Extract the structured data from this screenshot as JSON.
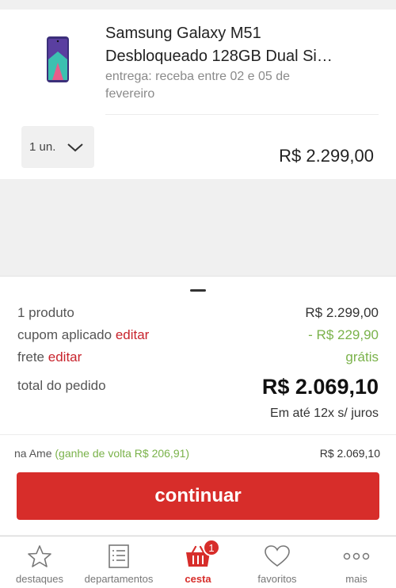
{
  "product": {
    "name_line1": "Samsung Galaxy M51",
    "name_line2": "Desbloqueado 128GB Dual Si…",
    "delivery_line1": "entrega: receba entre 02 e 05 de",
    "delivery_line2": "fevereiro",
    "quantity": "1 un.",
    "price": "R$ 2.299,00",
    "image_icon": "phone-thumbnail"
  },
  "summary": {
    "products_label": "1 produto",
    "products_value": "R$ 2.299,00",
    "coupon_label": "cupom aplicado",
    "coupon_edit": "editar",
    "coupon_value": "- R$ 229,90",
    "shipping_label": "frete",
    "shipping_edit": "editar",
    "shipping_value": "grátis",
    "total_label": "total do pedido",
    "total_value": "R$ 2.069,10",
    "installments": "Em até 12x s/ juros"
  },
  "ame": {
    "label": "na Ame",
    "cashback": "(ganhe de volta R$ 206,91)",
    "total": "R$ 2.069,10"
  },
  "cta_label": "continuar",
  "colors": {
    "brand_red": "#d72d2a",
    "green": "#7ab24a"
  },
  "tabbar": {
    "items": [
      {
        "label": "destaques",
        "icon": "star-icon"
      },
      {
        "label": "departamentos",
        "icon": "list-icon"
      },
      {
        "label": "cesta",
        "icon": "basket-icon",
        "badge": "1"
      },
      {
        "label": "favoritos",
        "icon": "heart-icon"
      },
      {
        "label": "mais",
        "icon": "more-icon"
      }
    ]
  }
}
